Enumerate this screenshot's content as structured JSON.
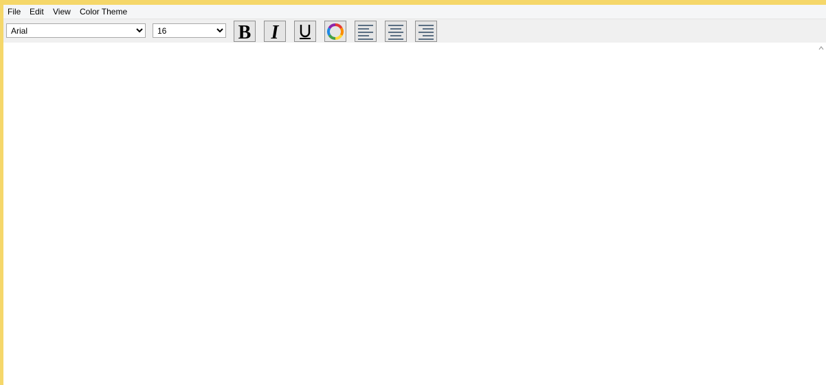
{
  "menu": {
    "file": "File",
    "edit": "Edit",
    "view": "View",
    "color_theme": "Color Theme"
  },
  "toolbar": {
    "font_family": "Arial",
    "font_size": "16",
    "bold_icon": "bold-icon",
    "italic_icon": "italic-icon",
    "underline_icon": "underline-icon",
    "color_icon": "color-wheel-icon",
    "align_left_icon": "align-left-icon",
    "align_center_icon": "align-center-icon",
    "align_right_icon": "align-right-icon"
  },
  "editor": {
    "content": ""
  },
  "colors": {
    "title_accent": "#f5d76a",
    "align_lines": "#5a6e82"
  }
}
